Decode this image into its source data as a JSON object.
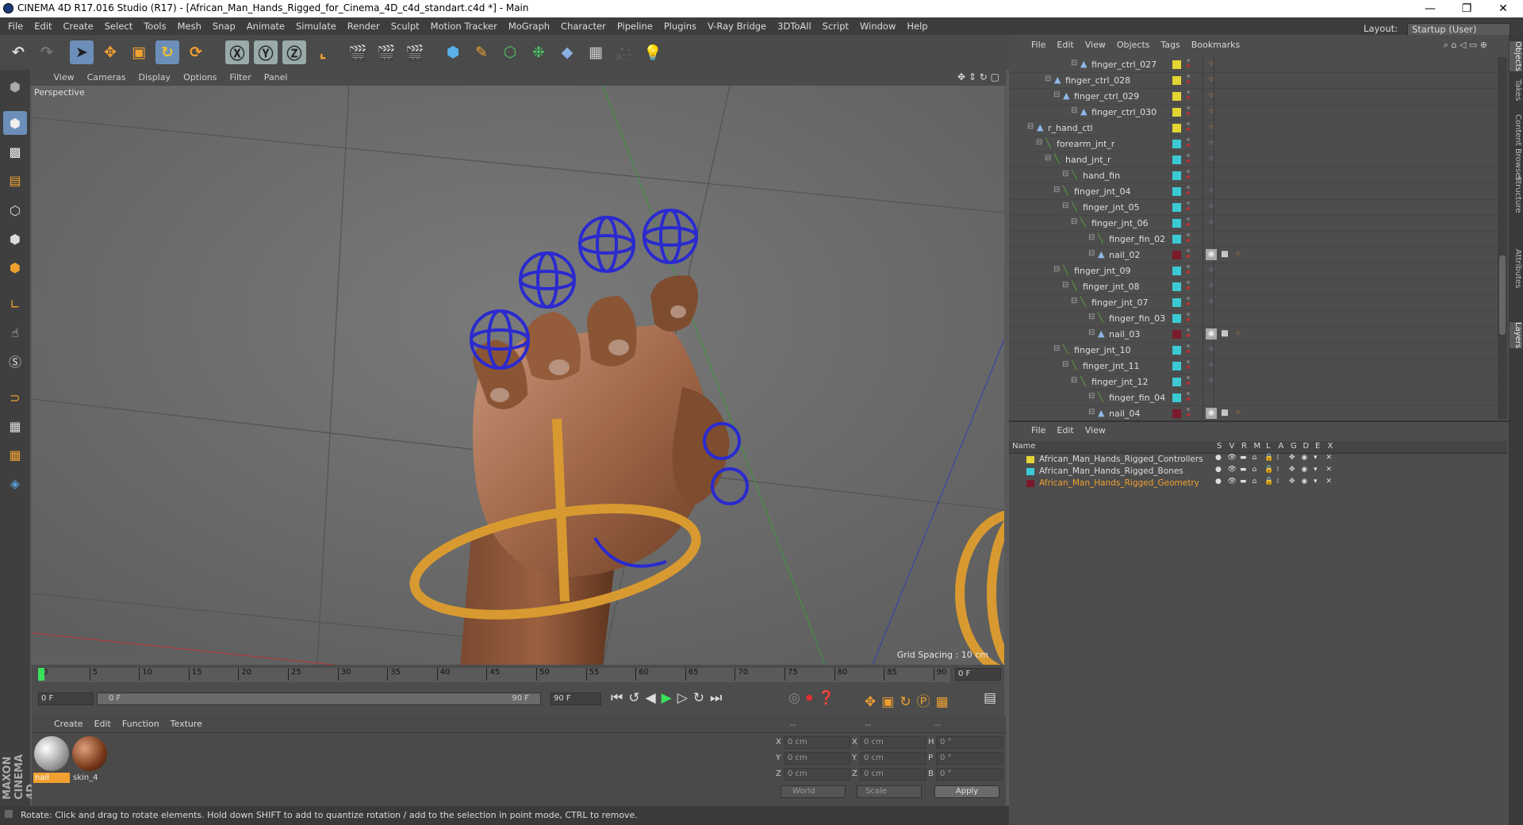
{
  "window": {
    "title": "CINEMA 4D R17.016 Studio (R17) - [African_Man_Hands_Rigged_for_Cinema_4D_c4d_standart.c4d *] - Main",
    "min": "—",
    "max": "❐",
    "close": "✕"
  },
  "menu": [
    "File",
    "Edit",
    "Create",
    "Select",
    "Tools",
    "Mesh",
    "Snap",
    "Animate",
    "Simulate",
    "Render",
    "Sculpt",
    "Motion Tracker",
    "MoGraph",
    "Character",
    "Pipeline",
    "Plugins",
    "V-Ray Bridge",
    "3DToAll",
    "Script",
    "Window",
    "Help"
  ],
  "layout": {
    "label": "Layout:",
    "value": "Startup (User)"
  },
  "viewport": {
    "menu": [
      "View",
      "Cameras",
      "Display",
      "Options",
      "Filter",
      "Panel"
    ],
    "label": "Perspective",
    "grid": "Grid Spacing : 10 cm"
  },
  "timeline": {
    "ticks": [
      "0",
      "5",
      "10",
      "15",
      "20",
      "25",
      "30",
      "35",
      "40",
      "45",
      "50",
      "55",
      "60",
      "65",
      "70",
      "75",
      "80",
      "85",
      "90"
    ],
    "current": "0 F"
  },
  "controls": {
    "start": "0 F",
    "range_start": "0 F",
    "range_end": "90 F",
    "end": "90 F"
  },
  "materials": {
    "menu": [
      "Create",
      "Edit",
      "Function",
      "Texture"
    ],
    "items": [
      {
        "name": "nail",
        "selected": true
      },
      {
        "name": "skin_4",
        "selected": false
      }
    ]
  },
  "coords": {
    "header": [
      "--",
      "--",
      "--"
    ],
    "rows": [
      {
        "a": "X",
        "av": "0 cm",
        "b": "X",
        "bv": "0 cm",
        "c": "H",
        "cv": "0 °"
      },
      {
        "a": "Y",
        "av": "0 cm",
        "b": "Y",
        "bv": "0 cm",
        "c": "P",
        "cv": "0 °"
      },
      {
        "a": "Z",
        "av": "0 cm",
        "b": "Z",
        "bv": "0 cm",
        "c": "B",
        "cv": "0 °"
      }
    ],
    "world": "World",
    "scale": "Scale",
    "apply": "Apply"
  },
  "status": "Rotate: Click and drag to rotate elements. Hold down SHIFT to add to quantize rotation / add to the selection in point mode, CTRL to remove.",
  "objects": {
    "menu": [
      "File",
      "Edit",
      "View",
      "Objects",
      "Tags",
      "Bookmarks"
    ],
    "rows": [
      {
        "name": "finger_ctrl_027",
        "indent": 8,
        "type": "nl",
        "color": "#e3d533"
      },
      {
        "name": "finger_ctrl_028",
        "indent": 5,
        "type": "nl",
        "color": "#e3d533"
      },
      {
        "name": "finger_ctrl_029",
        "indent": 6,
        "type": "nl",
        "color": "#e3d533"
      },
      {
        "name": "finger_ctrl_030",
        "indent": 8,
        "type": "nl",
        "color": "#e3d533"
      },
      {
        "name": "r_hand_ctl",
        "indent": 3,
        "type": "nl",
        "color": "#e3d533"
      },
      {
        "name": "forearm_jnt_r",
        "indent": 4,
        "type": "jt",
        "color": "#3bcad4"
      },
      {
        "name": "hand_jnt_r",
        "indent": 5,
        "type": "jt",
        "color": "#3bcad4"
      },
      {
        "name": "hand_fin",
        "indent": 7,
        "type": "jt",
        "color": "#3bcad4"
      },
      {
        "name": "finger_jnt_04",
        "indent": 6,
        "type": "jt",
        "color": "#3bcad4"
      },
      {
        "name": "finger_jnt_05",
        "indent": 7,
        "type": "jt",
        "color": "#3bcad4"
      },
      {
        "name": "finger_jnt_06",
        "indent": 8,
        "type": "jt",
        "color": "#3bcad4"
      },
      {
        "name": "finger_fin_02",
        "indent": 10,
        "type": "jt",
        "color": "#3bcad4"
      },
      {
        "name": "nail_02",
        "indent": 10,
        "type": "nl",
        "color": "#7a1a2a"
      },
      {
        "name": "finger_jnt_09",
        "indent": 6,
        "type": "jt",
        "color": "#3bcad4"
      },
      {
        "name": "finger_jnt_08",
        "indent": 7,
        "type": "jt",
        "color": "#3bcad4"
      },
      {
        "name": "finger_jnt_07",
        "indent": 8,
        "type": "jt",
        "color": "#3bcad4"
      },
      {
        "name": "finger_fin_03",
        "indent": 10,
        "type": "jt",
        "color": "#3bcad4"
      },
      {
        "name": "nail_03",
        "indent": 10,
        "type": "nl",
        "color": "#7a1a2a"
      },
      {
        "name": "finger_jnt_10",
        "indent": 6,
        "type": "jt",
        "color": "#3bcad4"
      },
      {
        "name": "finger_jnt_11",
        "indent": 7,
        "type": "jt",
        "color": "#3bcad4"
      },
      {
        "name": "finger_jnt_12",
        "indent": 8,
        "type": "jt",
        "color": "#3bcad4"
      },
      {
        "name": "finger_fin_04",
        "indent": 10,
        "type": "jt",
        "color": "#3bcad4"
      },
      {
        "name": "nail_04",
        "indent": 10,
        "type": "nl",
        "color": "#7a1a2a"
      }
    ]
  },
  "layers": {
    "menu": [
      "File",
      "Edit",
      "View"
    ],
    "header": "Name",
    "cols": [
      "S",
      "V",
      "R",
      "M",
      "L",
      "A",
      "G",
      "D",
      "E",
      "X"
    ],
    "rows": [
      {
        "name": "African_Man_Hands_Rigged_Controllers",
        "color": "#e3d533",
        "highlight": false
      },
      {
        "name": "African_Man_Hands_Rigged_Bones",
        "color": "#3bcad4",
        "highlight": false
      },
      {
        "name": "African_Man_Hands_Rigged_Geometry",
        "color": "#7a1a2a",
        "highlight": true
      }
    ]
  },
  "sidetabs": [
    "Objects",
    "Takes",
    "Content Browser",
    "Structure",
    "Attributes",
    "Layers"
  ],
  "brand": "MAXON CINEMA 4D"
}
